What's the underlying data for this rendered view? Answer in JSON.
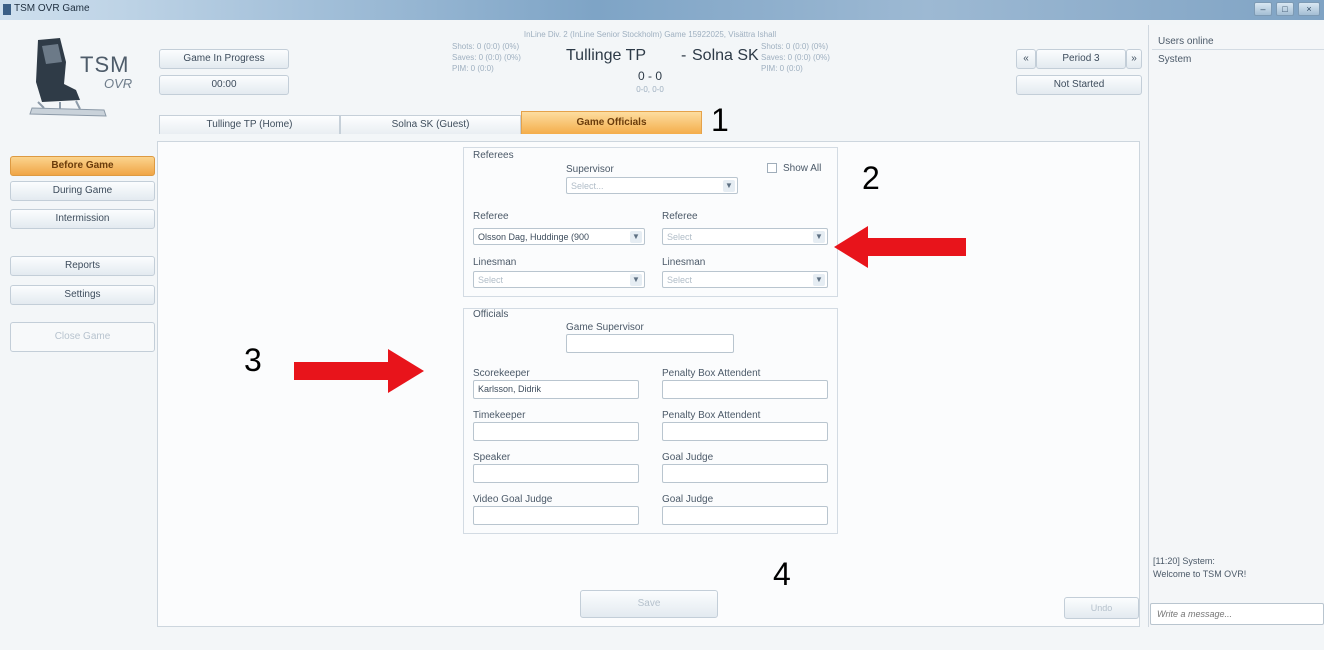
{
  "window": {
    "title": "TSM OVR Game",
    "min_glyph": "–",
    "max_glyph": "□",
    "close_glyph": "×"
  },
  "logo": {
    "line1": "TSM",
    "line2": "OVR"
  },
  "status": {
    "game_state": "Game In Progress",
    "clock": "00:00"
  },
  "scoreboard": {
    "subtitle": "InLine Div. 2 (InLine Senior Stockholm) Game 15922025, Visättra Ishall",
    "home_team": "Tullinge TP",
    "separator": "-",
    "away_team": "Solna SK",
    "score": "0 - 0",
    "period_scores": "0-0, 0-0",
    "home_stats": {
      "shots": "Shots: 0 (0:0) (0%)",
      "saves": "Saves: 0 (0:0) (0%)",
      "pim": "PIM: 0 (0:0)"
    },
    "away_stats": {
      "shots": "Shots: 0 (0:0) (0%)",
      "saves": "Saves: 0 (0:0) (0%)",
      "pim": "PIM: 0 (0:0)"
    }
  },
  "period": {
    "prev": "«",
    "label": "Period 3",
    "next": "»",
    "status": "Not Started"
  },
  "tabs": [
    {
      "label": "Tullinge TP  (Home)"
    },
    {
      "label": "Solna SK (Guest)"
    },
    {
      "label": "Game Officials"
    }
  ],
  "sidebar": {
    "items": [
      {
        "label": "Before Game"
      },
      {
        "label": "During Game"
      },
      {
        "label": "Intermission"
      },
      {
        "label": "Reports"
      },
      {
        "label": "Settings"
      },
      {
        "label": "Close Game"
      }
    ]
  },
  "referees": {
    "group_label": "Referees",
    "supervisor_label": "Supervisor",
    "supervisor_value": "Select...",
    "show_all": "Show All",
    "referee1_label": "Referee",
    "referee1_value": "Olsson Dag, Huddinge (900",
    "referee2_label": "Referee",
    "referee2_value": "Select",
    "linesman1_label": "Linesman",
    "linesman1_value": "Select",
    "linesman2_label": "Linesman",
    "linesman2_value": "Select"
  },
  "officials": {
    "group_label": "Officials",
    "game_supervisor_label": "Game Supervisor",
    "game_supervisor_value": "",
    "scorekeeper_label": "Scorekeeper",
    "scorekeeper_value": "Karlsson, Didrik",
    "pba1_label": "Penalty Box Attendent",
    "pba1_value": "",
    "timekeeper_label": "Timekeeper",
    "timekeeper_value": "",
    "pba2_label": "Penalty Box Attendent",
    "pba2_value": "",
    "speaker_label": "Speaker",
    "speaker_value": "",
    "goal_judge1_label": "Goal Judge",
    "goal_judge1_value": "",
    "video_goal_judge_label": "Video Goal Judge",
    "video_goal_judge_value": "",
    "goal_judge2_label": "Goal Judge",
    "goal_judge2_value": ""
  },
  "actions": {
    "save": "Save",
    "undo": "Undo"
  },
  "chat": {
    "users_header": "Users online",
    "users": [
      "System"
    ],
    "log_line1": "[11:20] System:",
    "log_line2": "Welcome to TSM OVR!",
    "input_placeholder": "Write a message..."
  },
  "annotations": {
    "n1": "1",
    "n2": "2",
    "n3": "3",
    "n4": "4",
    "arrow_color": "#e8141b"
  }
}
